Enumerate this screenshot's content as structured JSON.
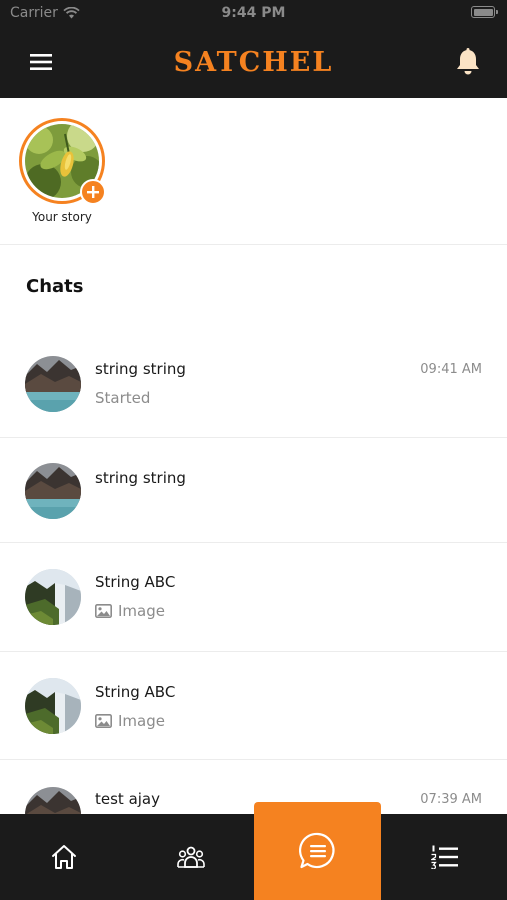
{
  "status": {
    "carrier": "Carrier",
    "time": "9:44 PM"
  },
  "header": {
    "title": "SATCHEL",
    "menu_icon": "hamburger-menu-icon",
    "bell_icon": "bell-icon"
  },
  "stories": [
    {
      "label": "Your story"
    }
  ],
  "chats_title": "Chats",
  "chats": [
    {
      "name": "string string",
      "subtitle": "Started",
      "time": "09:41 AM",
      "has_image_icon": false
    },
    {
      "name": "string string",
      "subtitle": "",
      "time": "",
      "has_image_icon": false
    },
    {
      "name": "String ABC",
      "subtitle": "Image",
      "time": "",
      "has_image_icon": true
    },
    {
      "name": "String ABC",
      "subtitle": "Image",
      "time": "",
      "has_image_icon": true
    },
    {
      "name": "test ajay",
      "subtitle": "",
      "time": "07:39 AM",
      "has_image_icon": false
    }
  ],
  "tabbar": {
    "items": [
      "home-icon",
      "groups-icon",
      "chat-icon",
      "list-icon"
    ],
    "active": "chat-icon"
  },
  "colors": {
    "accent": "#f58220",
    "dark": "#1b1b1b",
    "muted": "#8c8c8c"
  }
}
